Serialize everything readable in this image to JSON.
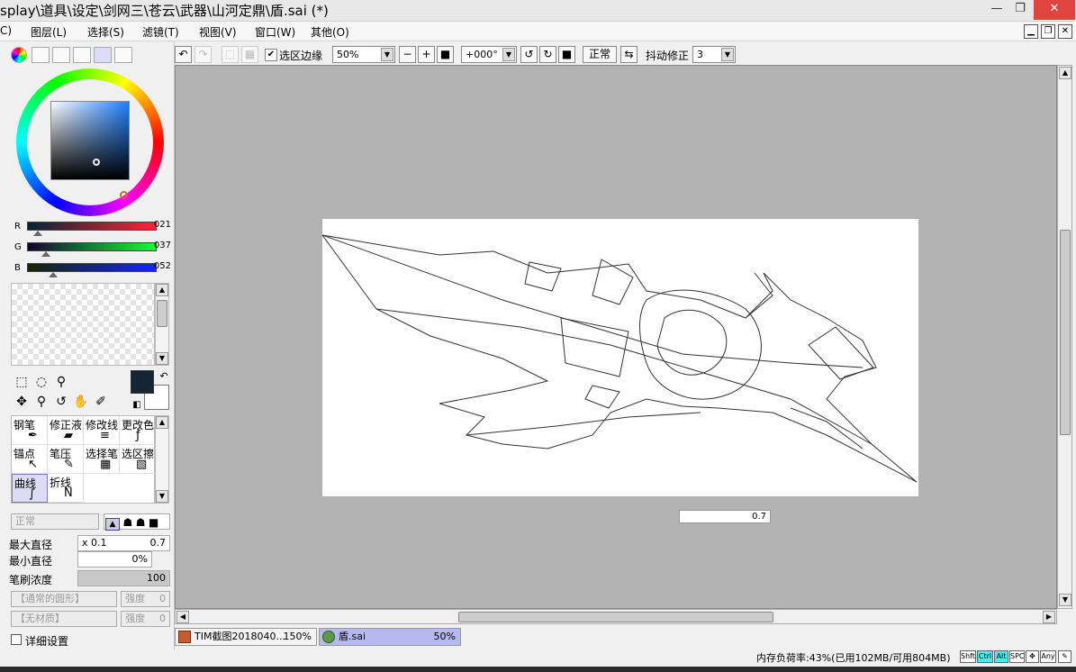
{
  "window": {
    "title": "splay\\道具\\设定\\剑网三\\苍云\\武器\\山河定鼎\\盾.sai (*)",
    "minimize": "—",
    "restore": "❐",
    "close": "✕"
  },
  "menu": [
    {
      "label": "C)"
    },
    {
      "label": "图层(L)"
    },
    {
      "label": "选择(S)"
    },
    {
      "label": "滤镜(T)"
    },
    {
      "label": "视图(V)"
    },
    {
      "label": "窗口(W)"
    },
    {
      "label": "其他(O)"
    }
  ],
  "color": {
    "current_hex": "#152534",
    "r_label": "R",
    "r_value": "021",
    "r_fraction": 0.082,
    "g_label": "G",
    "g_value": "037",
    "g_fraction": 0.145,
    "b_label": "B",
    "b_value": "052",
    "b_fraction": 0.204
  },
  "brushes": [
    {
      "label": "钢笔",
      "icon": "✒"
    },
    {
      "label": "修正液",
      "icon": "▰"
    },
    {
      "label": "修改线",
      "icon": "≡"
    },
    {
      "label": "更改色",
      "icon": "ƒ"
    },
    {
      "label": "锚点",
      "icon": "↖"
    },
    {
      "label": "笔压",
      "icon": "✎"
    },
    {
      "label": "选择笔",
      "icon": "▦"
    },
    {
      "label": "选区擦",
      "icon": "▧"
    },
    {
      "label": "曲线",
      "icon": "∫"
    },
    {
      "label": "折线",
      "icon": "N"
    }
  ],
  "brush_settings": {
    "blend_mode": "正常",
    "max_diameter_label": "最大直径",
    "max_diameter_multiplier": "x 0.1",
    "max_diameter_value": "0.7",
    "min_diameter_label": "最小直径",
    "min_diameter_value": "0%",
    "density_label": "笔刷浓度",
    "density_value": "100",
    "shape": "【通常的圆形】",
    "shape_strength_label": "强度",
    "shape_strength": "0",
    "texture": "【无材质】",
    "texture_strength_label": "强度",
    "texture_strength": "0",
    "detail_label": "详细设置"
  },
  "toolbar": {
    "selection_edge_label": "选区边缘",
    "zoom": "50%",
    "rotation": "+000°",
    "mode": "正常",
    "stabilizer_label": "抖动修正",
    "stabilizer_value": "3"
  },
  "canvas": {
    "size_indicator": "0.7"
  },
  "documents": [
    {
      "name": "TIM截图2018040...",
      "zoom": "150%",
      "active": false
    },
    {
      "name": "盾.sai",
      "zoom": "50%",
      "active": true
    }
  ],
  "status": {
    "memory": "内存负荷率:43%(已用102MB/可用804MB)",
    "keys": [
      "Shft",
      "Ctrl",
      "Alt",
      "SPC",
      "✥",
      "Any",
      "✎"
    ]
  }
}
